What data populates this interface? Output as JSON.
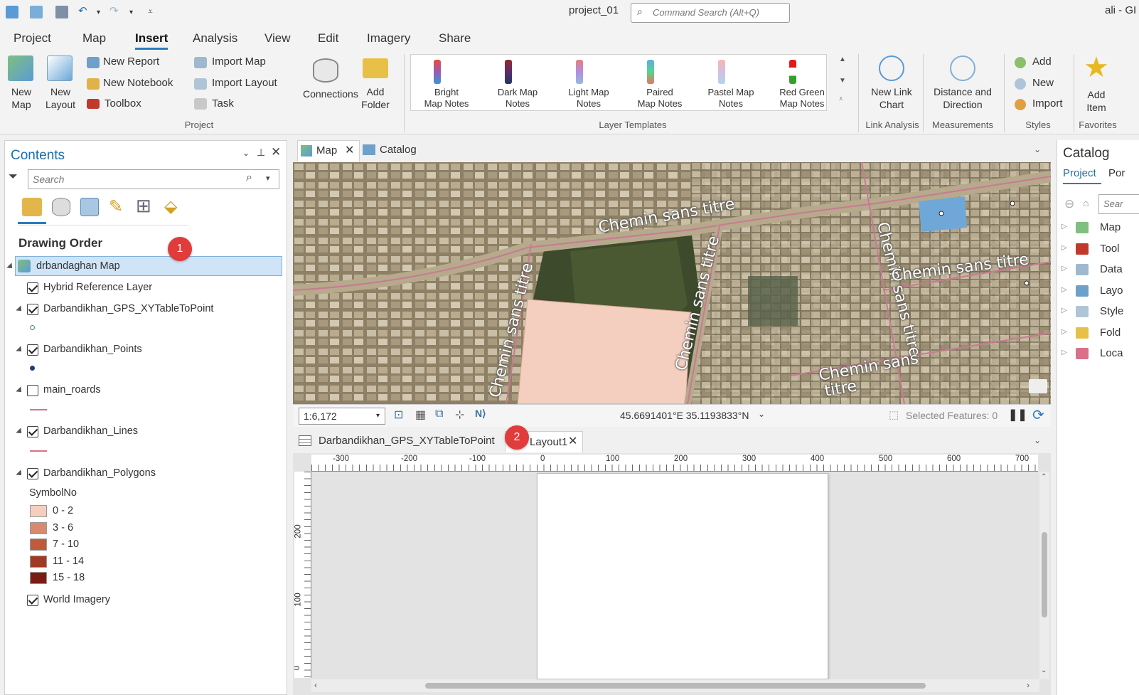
{
  "titlebar": {
    "project_name": "project_01",
    "command_search_placeholder": "Command Search (Alt+Q)",
    "user": "ali - GI"
  },
  "ribbon_tabs": [
    "Project",
    "Map",
    "Insert",
    "Analysis",
    "View",
    "Edit",
    "Imagery",
    "Share"
  ],
  "ribbon": {
    "new_map": "New Map",
    "new_layout": "New Layout",
    "new_report": "New Report",
    "new_notebook": "New Notebook",
    "toolbox": "Toolbox",
    "import_map": "Import Map",
    "import_layout": "Import Layout",
    "task": "Task",
    "connections": "Connections",
    "add_folder": "Add Folder",
    "group_project": "Project",
    "layer_templates": [
      {
        "line1": "Bright",
        "line2": "Map Notes"
      },
      {
        "line1": "Dark Map",
        "line2": "Notes"
      },
      {
        "line1": "Light Map",
        "line2": "Notes"
      },
      {
        "line1": "Paired",
        "line2": "Map Notes"
      },
      {
        "line1": "Pastel Map",
        "line2": "Notes"
      },
      {
        "line1": "Red Green",
        "line2": "Map Notes"
      }
    ],
    "group_layer_templates": "Layer Templates",
    "new_link_chart_1": "New Link",
    "new_link_chart_2": "Chart",
    "group_link_analysis": "Link Analysis",
    "distance_direction_1": "Distance and",
    "distance_direction_2": "Direction",
    "group_measurements": "Measurements",
    "styles_add": "Add",
    "styles_new": "New",
    "styles_import": "Import",
    "group_styles": "Styles",
    "add_item_1": "Add",
    "add_item_2": "Item",
    "group_favorites": "Favorites"
  },
  "contents": {
    "title": "Contents",
    "search_placeholder": "Search",
    "drawing_order": "Drawing Order",
    "map_name": "drbandaghan Map",
    "layers": {
      "hybrid": "Hybrid Reference Layer",
      "gps": "Darbandikhan_GPS_XYTableToPoint",
      "points": "Darbandikhan_Points",
      "roads": "main_roards",
      "lines": "Darbandikhan_Lines",
      "polygons": "Darbandikhan_Polygons",
      "symbol_field": "SymbolNo",
      "world": "World Imagery"
    },
    "legend": [
      {
        "label": "0 - 2",
        "color": "#f4cfc0"
      },
      {
        "label": "3 - 6",
        "color": "#d98a6e"
      },
      {
        "label": "7 - 10",
        "color": "#c05a3c"
      },
      {
        "label": "11 - 14",
        "color": "#a03a26"
      },
      {
        "label": "15 - 18",
        "color": "#7a1c14"
      }
    ]
  },
  "markers": {
    "m1": "1",
    "m2": "2"
  },
  "map_tabs": {
    "map": "Map",
    "catalog": "Catalog"
  },
  "map_labels": {
    "road1": "Chemin sans titre",
    "road2": "Chemin sans titre",
    "road3": "Chemin sans titre",
    "road4": "Chemin sans titre",
    "road5": "Chemin sans titre",
    "road6": "Chemin sans",
    "road6b": "titre"
  },
  "map_status": {
    "scale": "1:6,172",
    "coords": "45.6691401°E 35.1193833°N",
    "selected": "Selected Features: 0"
  },
  "layout_tabs": {
    "table": "Darbandikhan_GPS_XYTableToPoint",
    "layout": "Layout1"
  },
  "ruler": {
    "h": [
      "-300",
      "-200",
      "-100",
      "0",
      "100",
      "200",
      "300",
      "400",
      "500",
      "600",
      "700"
    ],
    "v": [
      "200",
      "100",
      "0"
    ]
  },
  "catalog": {
    "title": "Catalog",
    "tab_project": "Project",
    "tab_portal": "Por",
    "search": "Sear",
    "items": [
      "Map",
      "Tool",
      "Data",
      "Layo",
      "Style",
      "Fold",
      "Loca"
    ]
  },
  "colors": {
    "accent": "#2a7cbf",
    "pane_title": "#1a6fb0",
    "marker": "#e23b3b",
    "selection": "#cfe5f7"
  }
}
